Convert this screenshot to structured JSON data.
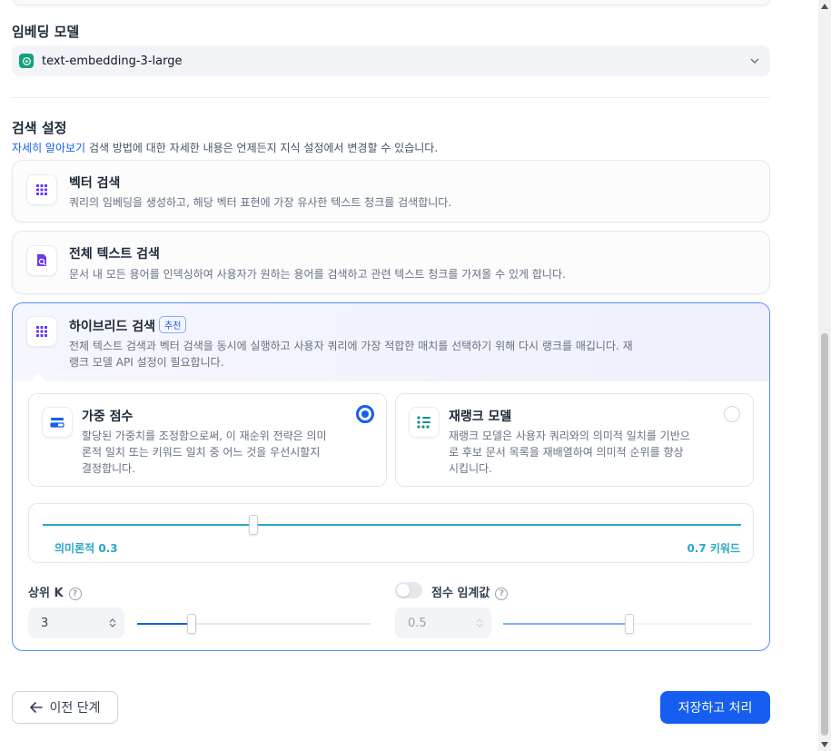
{
  "embedding": {
    "title": "임베딩 모델",
    "model": "text-embedding-3-large",
    "logo_icon": "openai-logo-icon"
  },
  "search": {
    "title": "검색 설정",
    "learn_more": "자세히 알아보기",
    "description": "검색 방법에 대한 자세한 내용은 언제든지 지식 설정에서 변경할 수 있습니다.",
    "vector": {
      "title": "벡터 검색",
      "desc": "쿼리의 임베딩을 생성하고, 해당 벡터 표현에 가장 유사한 텍스트 청크를 검색합니다."
    },
    "fulltext": {
      "title": "전체 텍스트 검색",
      "desc": "문서 내 모든 용어를 인덱싱하여 사용자가 원하는 용어를 검색하고 관련 텍스트 청크를 가져올 수 있게 합니다."
    },
    "hybrid": {
      "title": "하이브리드 검색",
      "badge": "추천",
      "desc_line1": "전체 텍스트 검색과 벡터 검색을 동시에 실행하고 사용자 쿼리에 가장 적합한 매치를 선택하기 위해 다시 랭크를 매깁니다. 재",
      "desc_line2": "랭크 모델 API 설정이 필요합니다.",
      "weighted": {
        "title": "가중 점수",
        "desc_line1": "할당된 가중치를 조정함으로써, 이 재순위 전략은 의미",
        "desc_line2": "론적 일치 또는 키워드 일치 중 어느 것을 우선시할지",
        "desc_line3": "결정합니다.",
        "selected": true
      },
      "rerank": {
        "title": "재랭크 모델",
        "desc_line1": "재랭크 모델은 사용자 쿼리와의 의미적 일치를 기반으",
        "desc_line2": "로 후보 문서 목록을 재배열하여 의미적 순위를 향상",
        "desc_line3": "시킵니다.",
        "selected": false
      },
      "weight_slider": {
        "semantic_label": "의미론적 0.3",
        "keyword_label": "0.7 키워드",
        "semantic": 0.3,
        "keyword": 0.7
      },
      "top_k": {
        "label": "상위 K",
        "value": "3",
        "slider_fraction": 0.23
      },
      "score_threshold": {
        "label": "점수 임계값",
        "enabled": false,
        "value": "0.5",
        "slider_fraction": 0.5
      }
    }
  },
  "footer": {
    "prev": "이전 단계",
    "save": "저장하고 처리"
  },
  "colors": {
    "accent": "#155eef",
    "slider": "#2aa6c9"
  }
}
